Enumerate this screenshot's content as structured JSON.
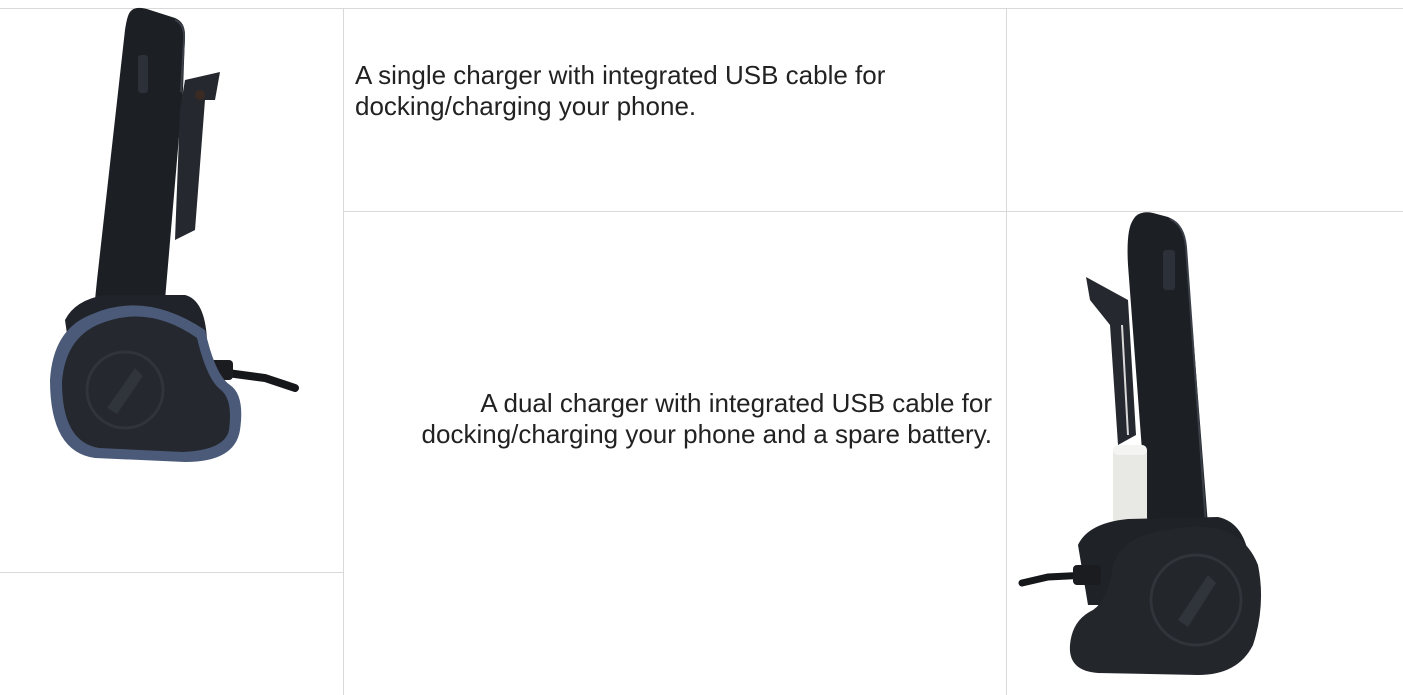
{
  "rows": [
    {
      "description": "A single charger with integrated USB cable for docking/charging your phone.",
      "image_icon": "single-charger-photo"
    },
    {
      "description": "A dual charger with integrated USB cable for docking/charging your phone and a spare battery.",
      "image_icon": "dual-charger-photo"
    }
  ],
  "colors": {
    "grid_line": "#d9d9d9",
    "text": "#222222",
    "phone_body": "#1c1f24",
    "dock_blue": "#4a5a78"
  }
}
